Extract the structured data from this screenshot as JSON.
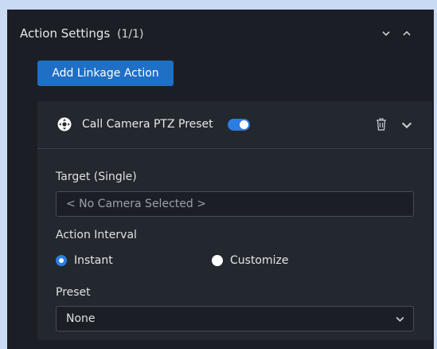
{
  "section": {
    "title": "Action Settings",
    "count": "(1/1)"
  },
  "add_button_label": "Add Linkage Action",
  "action": {
    "title": "Call Camera PTZ Preset",
    "enabled": true,
    "icon": "ptz-camera-icon"
  },
  "target": {
    "label": "Target (Single)",
    "placeholder": "< No Camera Selected >"
  },
  "interval": {
    "label": "Action Interval",
    "options": [
      "Instant",
      "Customize"
    ],
    "selected": "Instant"
  },
  "preset": {
    "label": "Preset",
    "value": "None"
  },
  "colors": {
    "accent": "#2a7de1",
    "button": "#1f6fc4",
    "panel": "#1b1f25",
    "card": "#23272e",
    "backdrop": "#c9dbf4"
  }
}
